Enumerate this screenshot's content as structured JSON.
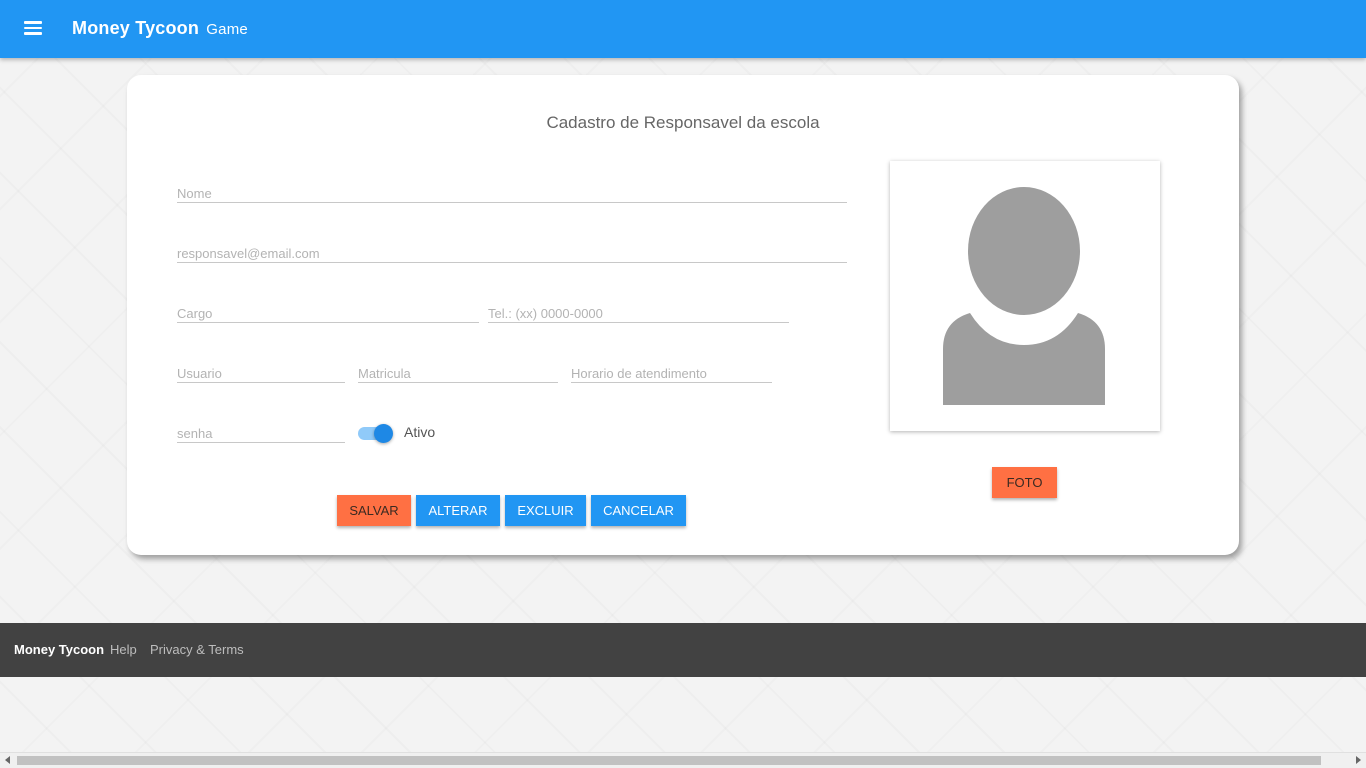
{
  "app": {
    "title": "Money Tycoon",
    "subtitle": "Game",
    "accent": "#2196f3"
  },
  "form": {
    "title": "Cadastro de Responsavel da escola",
    "fields": {
      "nome": "Nome",
      "email": "responsavel@email.com",
      "cargo": "Cargo",
      "telefone": "Tel.: (xx) 0000-0000",
      "usuario": "Usuario",
      "matricula": "Matricula",
      "horario": "Horario de atendimento",
      "senha": "senha"
    },
    "toggle": {
      "label": "Ativo",
      "on": true
    },
    "buttons": {
      "save": "SALVAR",
      "update": "ALTERAR",
      "delete": "EXCLUIR",
      "cancel": "CANCELAR"
    },
    "photo_button": "FOTO"
  },
  "footer": {
    "brand": "Money Tycoon",
    "links": [
      "Help",
      "Privacy & Terms"
    ]
  },
  "colors": {
    "primary": "#2196f3",
    "secondary": "#ff7043",
    "footer": "#424242"
  },
  "icons": {
    "menu": "menu-icon",
    "avatar": "person-silhouette-icon"
  }
}
